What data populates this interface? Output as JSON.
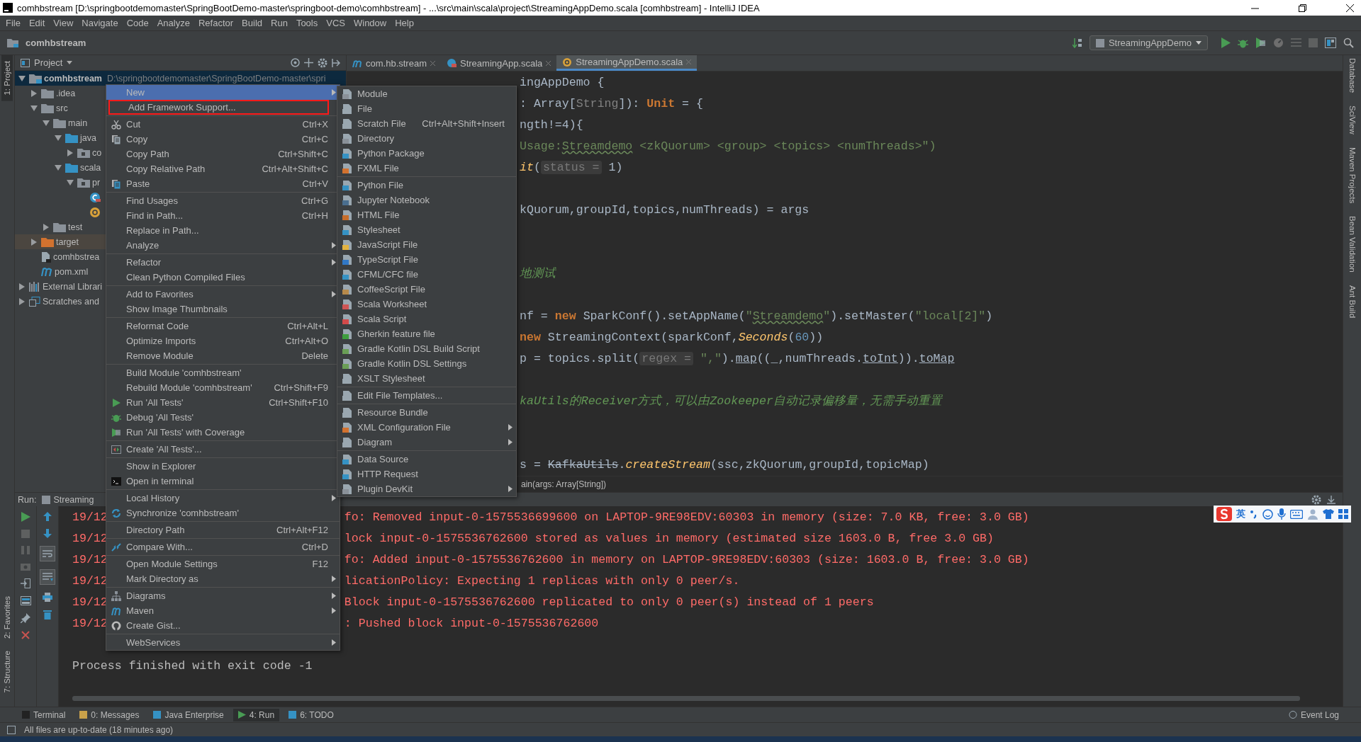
{
  "window": {
    "title": "comhbstream [D:\\springbootdemomaster\\SpringBootDemo-master\\springboot-demo\\comhbstream] - ...\\src\\main\\scala\\project\\StreamingAppDemo.scala [comhbstream] - IntelliJ IDEA"
  },
  "menu_bar": [
    "File",
    "Edit",
    "View",
    "Navigate",
    "Code",
    "Analyze",
    "Refactor",
    "Build",
    "Run",
    "Tools",
    "VCS",
    "Window",
    "Help"
  ],
  "nav_bar": {
    "project": "comhbstream",
    "run_config": "StreamingAppDemo"
  },
  "left_strip": [
    {
      "label": "1: Project",
      "selected": true
    },
    {
      "label": "2: Favorites",
      "selected": false
    },
    {
      "label": "7: Structure",
      "selected": false
    }
  ],
  "right_strip": [
    "Database",
    "SciView",
    "Maven Projects",
    "Bean Validation",
    "Ant Build"
  ],
  "project_panel": {
    "title": "Project",
    "tree": [
      {
        "label": "comhbstream",
        "path": "D:\\springbootdemomaster\\SpringBootDemo-master\\spri",
        "kind": "module",
        "expanded": true,
        "selected": true,
        "children": [
          {
            "label": ".idea",
            "kind": "folder",
            "expanded": false,
            "selected": false
          },
          {
            "label": "src",
            "kind": "folder",
            "expanded": true,
            "selected": false,
            "children": [
              {
                "label": "main",
                "kind": "folder",
                "expanded": true,
                "selected": false,
                "children": [
                  {
                    "label": "java",
                    "kind": "source",
                    "expanded": true,
                    "selected": false,
                    "children": [
                      {
                        "label": "co",
                        "kind": "package",
                        "expanded": false,
                        "selected": false
                      }
                    ]
                  },
                  {
                    "label": "scala",
                    "kind": "source",
                    "expanded": true,
                    "selected": false,
                    "children": [
                      {
                        "label": "pr",
                        "kind": "package",
                        "expanded": true,
                        "selected": false,
                        "children": [
                          {
                            "kind": "class",
                            "selected": false
                          },
                          {
                            "kind": "object",
                            "selected": false
                          }
                        ]
                      }
                    ]
                  }
                ]
              },
              {
                "label": "test",
                "kind": "folder",
                "expanded": false,
                "selected": false
              }
            ]
          },
          {
            "label": "target",
            "kind": "excluded",
            "expanded": false,
            "selected": false
          },
          {
            "label": "comhbstrea",
            "kind": "iml",
            "selected": false
          },
          {
            "label": "pom.xml",
            "kind": "maven",
            "selected": false
          }
        ]
      },
      {
        "label": "External Librari",
        "kind": "library",
        "expanded": false,
        "selected": false
      },
      {
        "label": "Scratches and",
        "kind": "scratches",
        "expanded": false,
        "selected": false
      }
    ]
  },
  "editor_tabs": [
    {
      "label": "com.hb.stream",
      "kind": "package",
      "selected": false
    },
    {
      "label": "StreamingApp.scala",
      "kind": "class",
      "selected": false
    },
    {
      "label": "StreamingAppDemo.scala",
      "kind": "object",
      "selected": true
    }
  ],
  "editor": {
    "lines": [
      {
        "segments": [
          {
            "text": "ingAppDemo {",
            "kind": "plain"
          }
        ]
      },
      {
        "segments": [
          {
            "text": ": Array[",
            "kind": "plain"
          },
          {
            "text": "String",
            "kind": "type"
          },
          {
            "text": "]): ",
            "kind": "plain"
          },
          {
            "text": "Unit",
            "kind": "keyword"
          },
          {
            "text": " = {",
            "kind": "plain"
          }
        ]
      },
      {
        "segments": [
          {
            "text": "ngth!=4){",
            "kind": "plain"
          }
        ]
      },
      {
        "segments": [
          {
            "text": "Usage:",
            "kind": "string"
          },
          {
            "text": "Streamdemo",
            "kind": "typo"
          },
          {
            "text": " <zkQuorum> <group> <topics> <numThreads>\")",
            "kind": "string"
          }
        ]
      },
      {
        "segments": [
          {
            "text": "it",
            "kind": "static"
          },
          {
            "text": "(",
            "kind": "plain"
          },
          {
            "text": "status =",
            "kind": "hint"
          },
          {
            "text": " 1)",
            "kind": "plain"
          }
        ]
      },
      {
        "kind": "blank"
      },
      {
        "segments": [
          {
            "text": "kQuorum,groupId,topics,numThreads) = args",
            "kind": "plain"
          }
        ]
      },
      {
        "kind": "blank"
      },
      {
        "kind": "blank"
      },
      {
        "segments": [
          {
            "text": "地测试",
            "kind": "comment"
          }
        ]
      },
      {
        "kind": "blank"
      },
      {
        "segments": [
          {
            "text": "nf = ",
            "kind": "plain"
          },
          {
            "text": "new",
            "kind": "keyword"
          },
          {
            "text": " SparkConf().setAppName(",
            "kind": "plain"
          },
          {
            "text": "\"",
            "kind": "string"
          },
          {
            "text": "Streamdemo",
            "kind": "typo"
          },
          {
            "text": "\"",
            "kind": "string"
          },
          {
            "text": ").setMaster(",
            "kind": "plain"
          },
          {
            "text": "\"local[2]\"",
            "kind": "string"
          },
          {
            "text": ")",
            "kind": "plain"
          }
        ]
      },
      {
        "segments": [
          {
            "text": "new",
            "kind": "keyword"
          },
          {
            "text": " StreamingContext(sparkConf,",
            "kind": "plain"
          },
          {
            "text": "Seconds",
            "kind": "static"
          },
          {
            "text": "(",
            "kind": "plain"
          },
          {
            "text": "60",
            "kind": "number"
          },
          {
            "text": "))",
            "kind": "plain"
          }
        ]
      },
      {
        "segments": [
          {
            "text": "p = topics.split(",
            "kind": "plain"
          },
          {
            "text": "regex =",
            "kind": "hint"
          },
          {
            "text": " \",\"",
            "kind": "string"
          },
          {
            "text": ").",
            "kind": "plain"
          },
          {
            "text": "map",
            "kind": "implicit"
          },
          {
            "text": "((_,numThreads.",
            "kind": "plain"
          },
          {
            "text": "toInt",
            "kind": "implicit"
          },
          {
            "text": ")).",
            "kind": "plain"
          },
          {
            "text": "toMap",
            "kind": "implicit"
          }
        ]
      },
      {
        "kind": "blank"
      },
      {
        "segments": [
          {
            "text": "kaUtils的Receiver方式，可以由Zookeeper自动记录偏移量，无需手动重置",
            "kind": "comment"
          }
        ]
      },
      {
        "kind": "blank"
      },
      {
        "kind": "blank"
      },
      {
        "segments": [
          {
            "text": "s = ",
            "kind": "plain"
          },
          {
            "text": "KafkaUtils",
            "kind": "strike"
          },
          {
            "text": ".",
            "kind": "plain"
          },
          {
            "text": "createStream",
            "kind": "static"
          },
          {
            "text": "(ssc,zkQuorum,groupId,topicMap)",
            "kind": "plain"
          }
        ]
      }
    ],
    "breadcrumb": "ain(args: Array[String])"
  },
  "run_panel": {
    "label": "Run:",
    "tab": "Streaming",
    "console": [
      {
        "prefix": "19/12",
        "text": "fo: Removed input-0-1575536699600 on LAPTOP-9RE98EDV:60303 in memory (size: 7.0 KB, free: 3.0 GB)"
      },
      {
        "prefix": "19/12",
        "text": "lock input-0-1575536762600 stored as values in memory (estimated size 1603.0 B, free 3.0 GB)"
      },
      {
        "prefix": "19/12",
        "text": "fo: Added input-0-1575536762600 in memory on LAPTOP-9RE98EDV:60303 (size: 1603.0 B, free: 3.0 GB)"
      },
      {
        "prefix": "19/12",
        "text": "licationPolicy: Expecting 1 replicas with only 0 peer/s."
      },
      {
        "prefix": "19/12",
        "text": "Block input-0-1575536762600 replicated to only 0 peer(s) instead of 1 peers"
      },
      {
        "prefix": "19/12",
        "text": ": Pushed block input-0-1575536762600"
      }
    ],
    "exit_message": "Process finished with exit code -1"
  },
  "ime_toolbar": {
    "mode": "英"
  },
  "context_menu": {
    "sections": [
      {
        "items": [
          {
            "label": "New",
            "has_submenu": true,
            "selected": true
          },
          {
            "label": "Add Framework Support...",
            "has_submenu": false,
            "selected": false,
            "annotated": true
          }
        ]
      },
      {
        "items": [
          {
            "label": "Cut",
            "shortcut": "Ctrl+X",
            "kind": "cut",
            "has_submenu": false,
            "selected": false
          },
          {
            "label": "Copy",
            "shortcut": "Ctrl+C",
            "kind": "copy",
            "has_submenu": false,
            "selected": false
          },
          {
            "label": "Copy Path",
            "shortcut": "Ctrl+Shift+C",
            "has_submenu": false,
            "selected": false
          },
          {
            "label": "Copy Relative Path",
            "shortcut": "Ctrl+Alt+Shift+C",
            "has_submenu": false,
            "selected": false
          },
          {
            "label": "Paste",
            "shortcut": "Ctrl+V",
            "kind": "paste",
            "has_submenu": false,
            "selected": false
          }
        ]
      },
      {
        "items": [
          {
            "label": "Find Usages",
            "shortcut": "Ctrl+G",
            "has_submenu": false,
            "selected": false
          },
          {
            "label": "Find in Path...",
            "shortcut": "Ctrl+H",
            "has_submenu": false,
            "selected": false
          },
          {
            "label": "Replace in Path...",
            "has_submenu": false,
            "selected": false
          },
          {
            "label": "Analyze",
            "has_submenu": true,
            "selected": false
          }
        ]
      },
      {
        "items": [
          {
            "label": "Refactor",
            "has_submenu": true,
            "selected": false
          },
          {
            "label": "Clean Python Compiled Files",
            "has_submenu": false,
            "selected": false
          }
        ]
      },
      {
        "items": [
          {
            "label": "Add to Favorites",
            "has_submenu": true,
            "selected": false
          },
          {
            "label": "Show Image Thumbnails",
            "has_submenu": false,
            "selected": false
          }
        ]
      },
      {
        "items": [
          {
            "label": "Reformat Code",
            "shortcut": "Ctrl+Alt+L",
            "has_submenu": false,
            "selected": false
          },
          {
            "label": "Optimize Imports",
            "shortcut": "Ctrl+Alt+O",
            "has_submenu": false,
            "selected": false
          },
          {
            "label": "Remove Module",
            "shortcut": "Delete",
            "has_submenu": false,
            "selected": false
          }
        ]
      },
      {
        "items": [
          {
            "label": "Build Module 'comhbstream'",
            "has_submenu": false,
            "selected": false
          },
          {
            "label": "Rebuild Module 'comhbstream'",
            "shortcut": "Ctrl+Shift+F9",
            "has_submenu": false,
            "selected": false
          },
          {
            "label": "Run 'All Tests'",
            "shortcut": "Ctrl+Shift+F10",
            "kind": "run",
            "has_submenu": false,
            "selected": false
          },
          {
            "label": "Debug 'All Tests'",
            "kind": "debug",
            "has_submenu": false,
            "selected": false
          },
          {
            "label": "Run 'All Tests' with Coverage",
            "kind": "coverage",
            "has_submenu": false,
            "selected": false
          }
        ]
      },
      {
        "items": [
          {
            "label": "Create 'All Tests'...",
            "kind": "create-test",
            "has_submenu": false,
            "selected": false
          }
        ]
      },
      {
        "items": [
          {
            "label": "Show in Explorer",
            "has_submenu": false,
            "selected": false
          },
          {
            "label": "Open in terminal",
            "kind": "terminal",
            "has_submenu": false,
            "selected": false
          }
        ]
      },
      {
        "items": [
          {
            "label": "Local History",
            "has_submenu": true,
            "selected": false
          },
          {
            "label": "Synchronize 'comhbstream'",
            "kind": "sync",
            "has_submenu": false,
            "selected": false
          }
        ]
      },
      {
        "items": [
          {
            "label": "Directory Path",
            "shortcut": "Ctrl+Alt+F12",
            "has_submenu": false,
            "selected": false
          }
        ]
      },
      {
        "items": [
          {
            "label": "Compare With...",
            "shortcut": "Ctrl+D",
            "kind": "compare",
            "has_submenu": false,
            "selected": false
          }
        ]
      },
      {
        "items": [
          {
            "label": "Open Module Settings",
            "shortcut": "F12",
            "has_submenu": false,
            "selected": false
          },
          {
            "label": "Mark Directory as",
            "has_submenu": true,
            "selected": false
          }
        ]
      },
      {
        "items": [
          {
            "label": "Diagrams",
            "kind": "diagram",
            "has_submenu": true,
            "selected": false
          },
          {
            "label": "Maven",
            "kind": "maven",
            "has_submenu": true,
            "selected": false
          },
          {
            "label": "Create Gist...",
            "kind": "gist",
            "has_submenu": false,
            "selected": false
          }
        ]
      },
      {
        "items": [
          {
            "label": "WebServices",
            "has_submenu": true,
            "selected": false
          }
        ]
      }
    ]
  },
  "new_submenu": {
    "sections": [
      {
        "items": [
          {
            "label": "Module",
            "has_submenu": false,
            "selected": false
          },
          {
            "label": "File",
            "has_submenu": false,
            "selected": false
          },
          {
            "label": "Scratch File",
            "shortcut": "Ctrl+Alt+Shift+Insert",
            "has_submenu": false,
            "selected": false
          },
          {
            "label": "Directory",
            "has_submenu": false,
            "selected": false
          },
          {
            "label": "Python Package",
            "has_submenu": false,
            "selected": false
          },
          {
            "label": "FXML File",
            "has_submenu": false,
            "selected": false
          }
        ]
      },
      {
        "items": [
          {
            "label": "Python File",
            "has_submenu": false,
            "selected": false
          },
          {
            "label": "Jupyter Notebook",
            "has_submenu": false,
            "selected": false
          },
          {
            "label": "HTML File",
            "has_submenu": false,
            "selected": false
          },
          {
            "label": "Stylesheet",
            "has_submenu": false,
            "selected": false
          },
          {
            "label": "JavaScript File",
            "has_submenu": false,
            "selected": false
          },
          {
            "label": "TypeScript File",
            "has_submenu": false,
            "selected": false
          },
          {
            "label": "CFML/CFC file",
            "has_submenu": false,
            "selected": false
          },
          {
            "label": "CoffeeScript File",
            "has_submenu": false,
            "selected": false
          },
          {
            "label": "Scala Worksheet",
            "has_submenu": false,
            "selected": false
          },
          {
            "label": "Scala Script",
            "has_submenu": false,
            "selected": false
          },
          {
            "label": "Gherkin feature file",
            "has_submenu": false,
            "selected": false
          },
          {
            "label": "Gradle Kotlin DSL Build Script",
            "has_submenu": false,
            "selected": false
          },
          {
            "label": "Gradle Kotlin DSL Settings",
            "has_submenu": false,
            "selected": false
          },
          {
            "label": "XSLT Stylesheet",
            "has_submenu": false,
            "selected": false
          }
        ]
      },
      {
        "items": [
          {
            "label": "Edit File Templates...",
            "has_submenu": false,
            "selected": false
          }
        ]
      },
      {
        "items": [
          {
            "label": "Resource Bundle",
            "has_submenu": false,
            "selected": false
          },
          {
            "label": "XML Configuration File",
            "has_submenu": true,
            "selected": false
          },
          {
            "label": "Diagram",
            "has_submenu": true,
            "selected": false
          }
        ]
      },
      {
        "items": [
          {
            "label": "Data Source",
            "has_submenu": false,
            "selected": false
          },
          {
            "label": "HTTP Request",
            "has_submenu": false,
            "selected": false
          },
          {
            "label": "Plugin DevKit",
            "has_submenu": true,
            "selected": false
          }
        ]
      }
    ]
  },
  "bottom_tabs": [
    {
      "label": "Terminal",
      "selected": false
    },
    {
      "label": "0: Messages",
      "selected": false
    },
    {
      "label": "Java Enterprise",
      "selected": false
    },
    {
      "label": "4: Run",
      "selected": true
    },
    {
      "label": "6: TODO",
      "selected": false
    }
  ],
  "event_log": "Event Log",
  "status_bar": "All files are up-to-date (18 minutes ago)"
}
